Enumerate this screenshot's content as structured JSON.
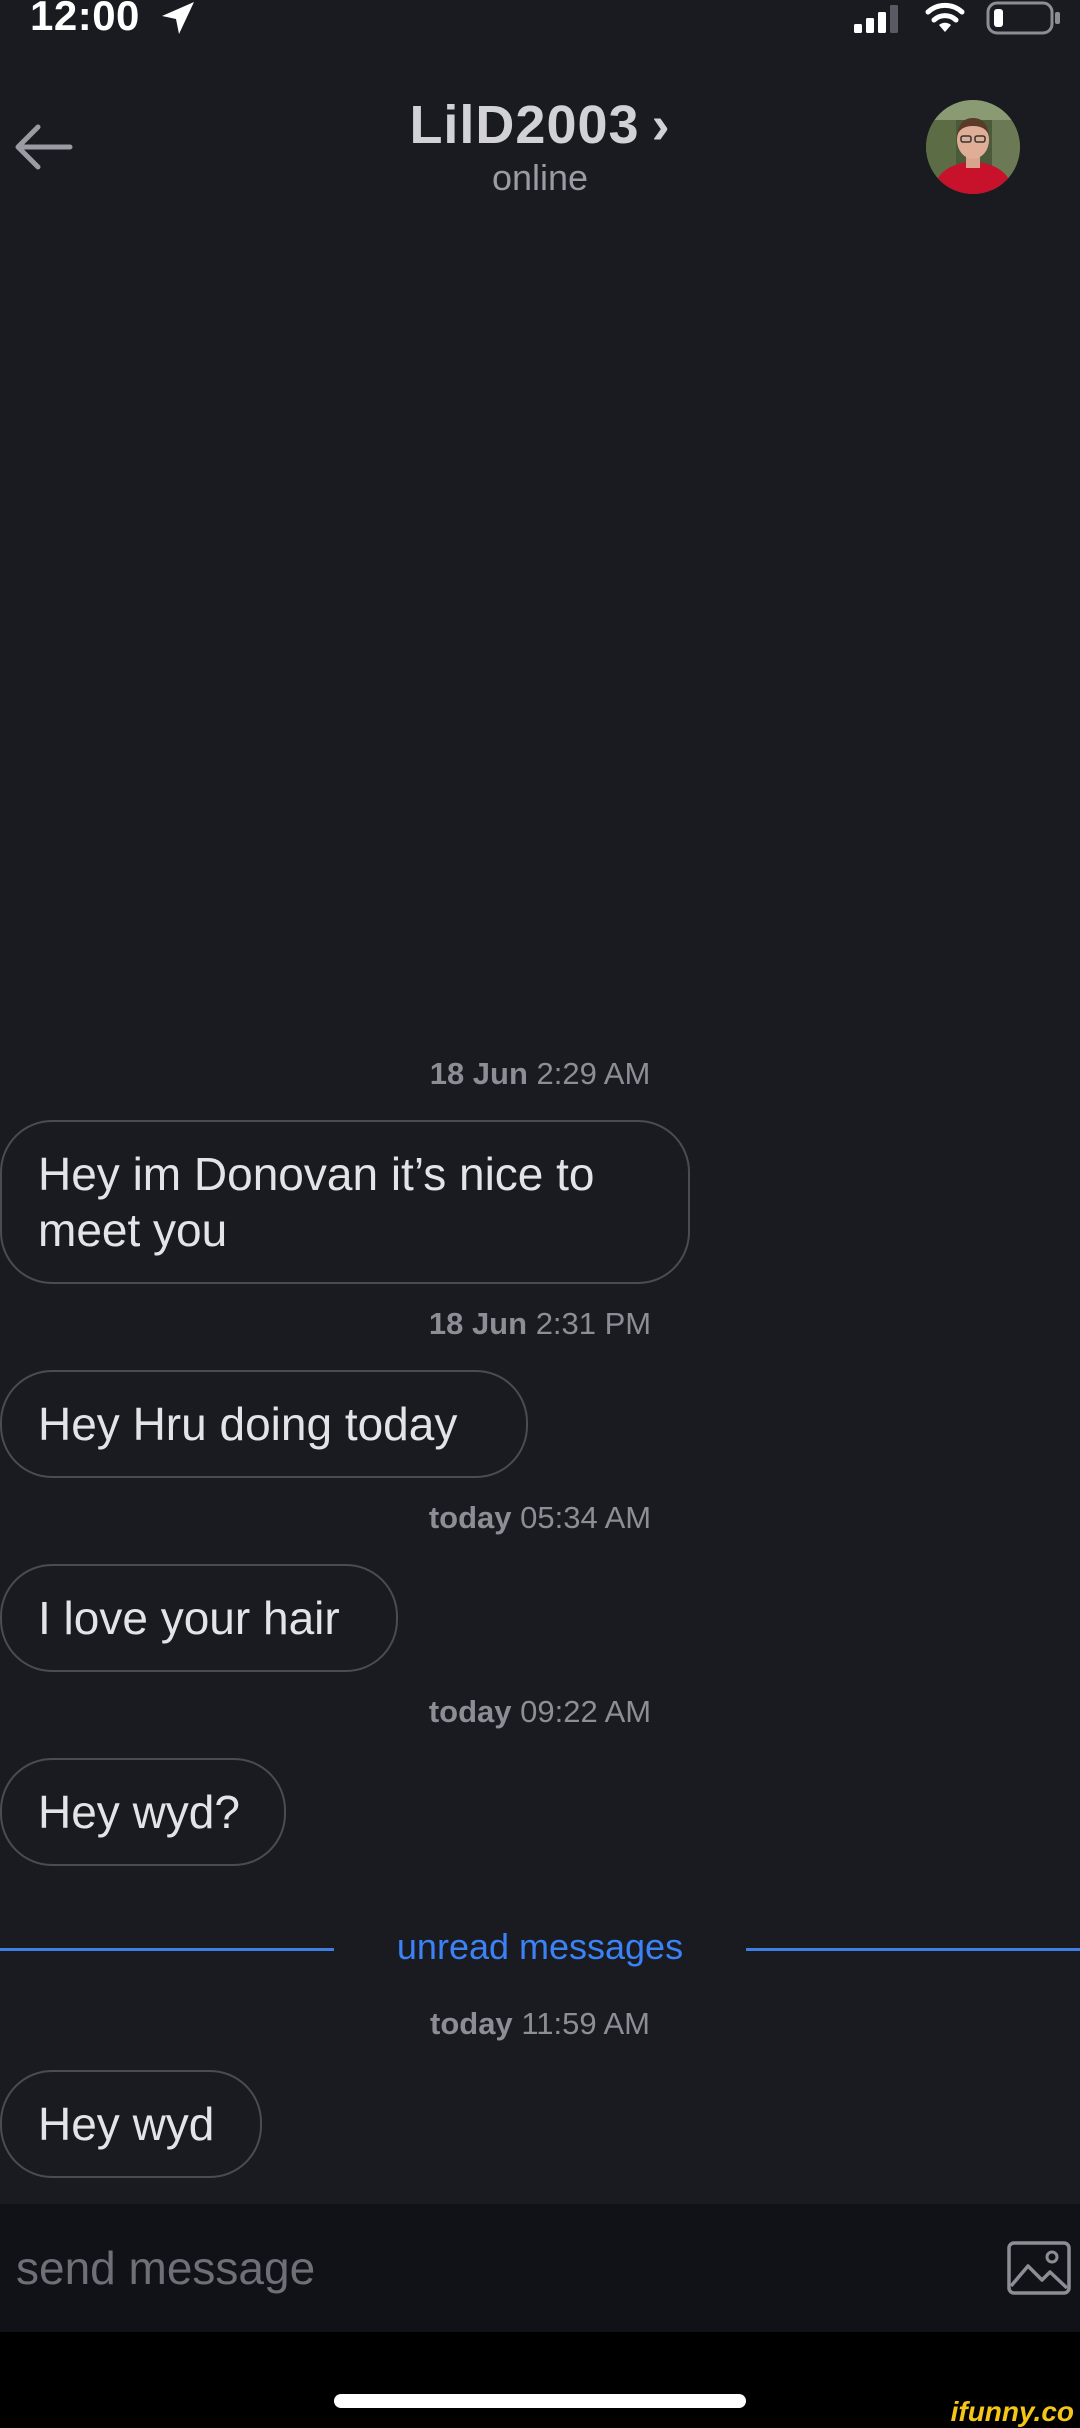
{
  "status_bar": {
    "time": "12:00"
  },
  "header": {
    "title": "LilD2003",
    "chevron": "›",
    "subtitle": "online",
    "back_icon": "arrow-left-icon"
  },
  "messages": [
    {
      "date": "18 Jun",
      "time": "2:29 AM",
      "lines": [
        "Hey im Donovan it’s nice to",
        "meet you"
      ]
    },
    {
      "date": "18 Jun",
      "time": "2:31 PM",
      "lines": [
        "Hey Hru doing today"
      ]
    },
    {
      "date": "today",
      "time": "05:34 AM",
      "lines": [
        "I love your hair"
      ]
    },
    {
      "date": "today",
      "time": "09:22 AM",
      "lines": [
        "Hey wyd?"
      ]
    },
    {
      "date": "today",
      "time": "11:59 AM",
      "lines": [
        "Hey wyd"
      ]
    }
  ],
  "unread_label": "unread messages",
  "composer": {
    "placeholder": "send message",
    "attach_icon": "image-icon"
  },
  "watermark": "ifunny.co",
  "colors": {
    "background": "#1a1b21",
    "bubble_border": "#4a4b53",
    "accent": "#3b82f6",
    "composer_bg": "#111218"
  }
}
